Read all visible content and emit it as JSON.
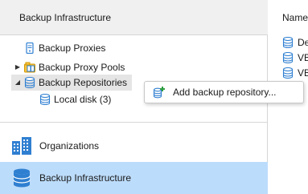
{
  "left_pane": {
    "title": "Backup Infrastructure",
    "tree": [
      {
        "label": "Backup Proxies",
        "icon": "server-icon",
        "expander": ""
      },
      {
        "label": "Backup Proxy Pools",
        "icon": "proxy-pool-icon",
        "expander": "▶"
      },
      {
        "label": "Backup Repositories",
        "icon": "repository-icon",
        "expander": "◢",
        "selected": true
      },
      {
        "label": "Local disk (3)",
        "icon": "repository-icon",
        "expander": ""
      }
    ]
  },
  "nav": {
    "organizations": "Organizations",
    "backup_infrastructure": "Backup Infrastructure"
  },
  "right_pane": {
    "column_header": "Name",
    "rows": [
      "De",
      "VB",
      "VB"
    ]
  },
  "context_menu": {
    "items": [
      {
        "label": "Add backup repository...",
        "icon": "add-repository-icon"
      }
    ]
  },
  "colors": {
    "selected_nav_bg": "#bcdcfb",
    "selected_tree_bg": "#e5e5e5",
    "icon_blue": "#2f7fd1",
    "icon_orange": "#f0a500",
    "plus_green": "#2e9e3f"
  }
}
